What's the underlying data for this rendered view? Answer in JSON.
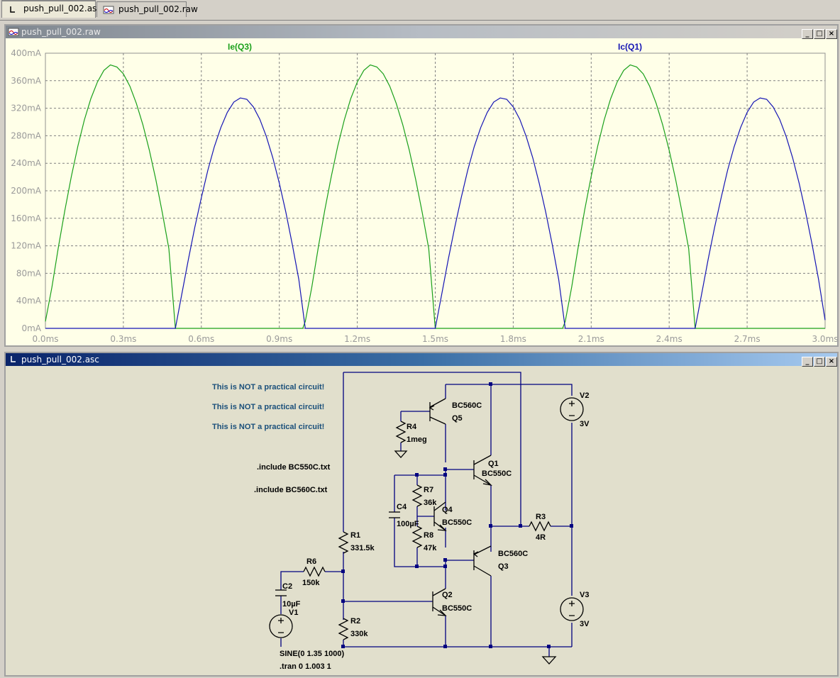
{
  "tabs": [
    {
      "label": "push_pull_002.asc",
      "active": true,
      "icon": "schematic-icon"
    },
    {
      "label": "push_pull_002.raw",
      "active": false,
      "icon": "waveform-icon"
    }
  ],
  "plot_window": {
    "title": "push_pull_002.raw",
    "buttons": [
      "minimize",
      "restore",
      "close"
    ]
  },
  "schematic_window": {
    "title": "push_pull_002.asc",
    "buttons": [
      "minimize",
      "restore",
      "close"
    ]
  },
  "colors": {
    "trace_ie_q3": "#1aa01a",
    "trace_ic_q1": "#1414b4",
    "plot_bg": "#ffffe8",
    "wire": "#000080",
    "warning_text": "#1a4f7a"
  },
  "chart_data": {
    "type": "line",
    "title": "",
    "xlabel": "",
    "ylabel": "",
    "x_ticks": [
      "0.0ms",
      "0.3ms",
      "0.6ms",
      "0.9ms",
      "1.2ms",
      "1.5ms",
      "1.8ms",
      "2.1ms",
      "2.4ms",
      "2.7ms",
      "3.0ms"
    ],
    "y_ticks": [
      "0mA",
      "40mA",
      "80mA",
      "120mA",
      "160mA",
      "200mA",
      "240mA",
      "280mA",
      "320mA",
      "360mA",
      "400mA"
    ],
    "xlim": [
      0,
      3.0
    ],
    "ylim": [
      0,
      400
    ],
    "grid": true,
    "series": [
      {
        "name": "Ie(Q3)",
        "x": [
          0.0,
          0.025,
          0.05,
          0.075,
          0.1,
          0.125,
          0.15,
          0.175,
          0.2,
          0.225,
          0.25,
          0.275,
          0.3,
          0.325,
          0.35,
          0.375,
          0.4,
          0.425,
          0.45,
          0.475,
          0.5,
          0.51,
          0.75,
          0.99,
          1.0,
          1.025,
          1.05,
          1.075,
          1.1,
          1.125,
          1.15,
          1.175,
          1.2,
          1.225,
          1.25,
          1.275,
          1.3,
          1.325,
          1.35,
          1.375,
          1.4,
          1.425,
          1.45,
          1.475,
          1.5,
          1.51,
          1.75,
          1.99,
          2.0,
          2.025,
          2.05,
          2.075,
          2.1,
          2.125,
          2.15,
          2.175,
          2.2,
          2.225,
          2.25,
          2.275,
          2.3,
          2.325,
          2.35,
          2.375,
          2.4,
          2.425,
          2.45,
          2.475,
          2.5,
          2.51,
          2.75,
          3.0
        ],
        "y": [
          10,
          60,
          118,
          172,
          221,
          265,
          303,
          334,
          358,
          375,
          383,
          380,
          370,
          352,
          327,
          296,
          259,
          216,
          168,
          116,
          0,
          0,
          0,
          0,
          10,
          60,
          118,
          172,
          221,
          265,
          303,
          334,
          358,
          375,
          383,
          380,
          370,
          352,
          327,
          296,
          259,
          216,
          168,
          116,
          0,
          0,
          0,
          0,
          10,
          60,
          118,
          172,
          221,
          265,
          303,
          334,
          358,
          375,
          383,
          380,
          370,
          352,
          327,
          296,
          259,
          216,
          168,
          116,
          0,
          0,
          0,
          0
        ]
      },
      {
        "name": "Ic(Q1)",
        "x": [
          0.0,
          0.49,
          0.5,
          0.525,
          0.55,
          0.575,
          0.6,
          0.625,
          0.65,
          0.675,
          0.7,
          0.725,
          0.75,
          0.775,
          0.8,
          0.825,
          0.85,
          0.875,
          0.9,
          0.925,
          0.95,
          0.975,
          1.0,
          1.01,
          1.49,
          1.5,
          1.525,
          1.55,
          1.575,
          1.6,
          1.625,
          1.65,
          1.675,
          1.7,
          1.725,
          1.75,
          1.775,
          1.8,
          1.825,
          1.85,
          1.875,
          1.9,
          1.925,
          1.95,
          1.975,
          2.0,
          2.01,
          2.49,
          2.5,
          2.525,
          2.55,
          2.575,
          2.6,
          2.625,
          2.65,
          2.675,
          2.7,
          2.725,
          2.75,
          2.775,
          2.8,
          2.825,
          2.85,
          2.875,
          2.9,
          2.925,
          2.95,
          2.975,
          3.0
        ],
        "y": [
          0,
          0,
          0,
          50,
          100,
          147,
          190,
          230,
          264,
          292,
          314,
          329,
          335,
          333,
          322,
          304,
          279,
          248,
          211,
          169,
          122,
          71,
          0,
          0,
          0,
          0,
          50,
          100,
          147,
          190,
          230,
          264,
          292,
          314,
          329,
          335,
          333,
          322,
          304,
          279,
          248,
          211,
          169,
          122,
          71,
          0,
          0,
          0,
          0,
          50,
          100,
          147,
          190,
          230,
          264,
          292,
          314,
          329,
          335,
          333,
          322,
          304,
          279,
          248,
          211,
          169,
          122,
          71,
          12
        ]
      }
    ]
  },
  "schematic": {
    "notes": [
      "This is NOT a practical circuit!",
      "This is NOT a practical circuit!",
      "This is NOT a practical circuit!"
    ],
    "includes": [
      ".include BC550C.txt",
      ".include BC560C.txt"
    ],
    "components": {
      "q5": {
        "model": "BC560C",
        "name": "Q5"
      },
      "r4": {
        "name": "R4",
        "value": "1meg"
      },
      "q1": {
        "name": "Q1",
        "model": "BC550C"
      },
      "r7": {
        "name": "R7",
        "value": "36k"
      },
      "c4": {
        "name": "C4",
        "value": "100µF"
      },
      "q4": {
        "name": "Q4",
        "model": "BC550C"
      },
      "r8": {
        "name": "R8",
        "value": "47k"
      },
      "r3": {
        "name": "R3",
        "value": "4R"
      },
      "q3": {
        "model": "BC560C",
        "name": "Q3"
      },
      "r1": {
        "name": "R1",
        "value": "331.5k"
      },
      "r6": {
        "name": "R6",
        "value": "150k"
      },
      "c2": {
        "name": "C2",
        "value": "10µF"
      },
      "v1": {
        "name": "V1",
        "value": "SINE(0 1.35 1000)"
      },
      "q2": {
        "name": "Q2",
        "model": "BC550C"
      },
      "r2": {
        "name": "R2",
        "value": "330k"
      },
      "v2": {
        "name": "V2",
        "value": "3V"
      },
      "v3": {
        "name": "V3",
        "value": "3V"
      }
    },
    "directive": ".tran 0 1.003 1"
  }
}
